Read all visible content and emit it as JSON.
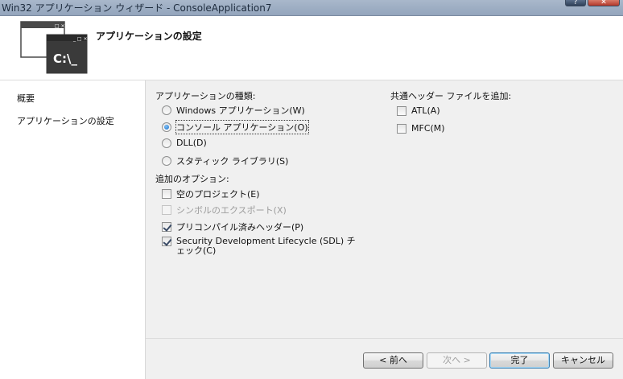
{
  "window": {
    "title": "Win32 アプリケーション ウィザード - ConsoleApplication7",
    "help_label": "?",
    "close_label": "✕"
  },
  "header": {
    "title": "アプリケーションの設定",
    "icon_text": "C:\\_",
    "icon_back_glyphs": "_ □ ×",
    "icon_front_glyphs": "_ □ ×"
  },
  "nav": {
    "items": [
      {
        "label": "概要"
      },
      {
        "label": "アプリケーションの設定"
      }
    ]
  },
  "app_type": {
    "label": "アプリケーションの種類:",
    "options": [
      {
        "label": "Windows アプリケーション(W)",
        "checked": false
      },
      {
        "label": "コンソール アプリケーション(O)",
        "checked": true
      },
      {
        "label": "DLL(D)",
        "checked": false
      },
      {
        "label": "スタティック ライブラリ(S)",
        "checked": false
      }
    ]
  },
  "extra_options": {
    "label": "追加のオプション:",
    "options": [
      {
        "label": "空のプロジェクト(E)",
        "checked": false,
        "enabled": true
      },
      {
        "label": "シンボルのエクスポート(X)",
        "checked": false,
        "enabled": false
      },
      {
        "label": "プリコンパイル済みヘッダー(P)",
        "checked": true,
        "enabled": true
      },
      {
        "label": "Security Development Lifecycle (SDL) チェック(C)",
        "checked": true,
        "enabled": true
      }
    ]
  },
  "common_headers": {
    "label": "共通ヘッダー ファイルを追加:",
    "options": [
      {
        "label": "ATL(A)",
        "checked": false
      },
      {
        "label": "MFC(M)",
        "checked": false
      }
    ]
  },
  "buttons": {
    "back": "< 前へ",
    "next": "次へ >",
    "finish": "完了",
    "cancel": "キャンセル"
  }
}
